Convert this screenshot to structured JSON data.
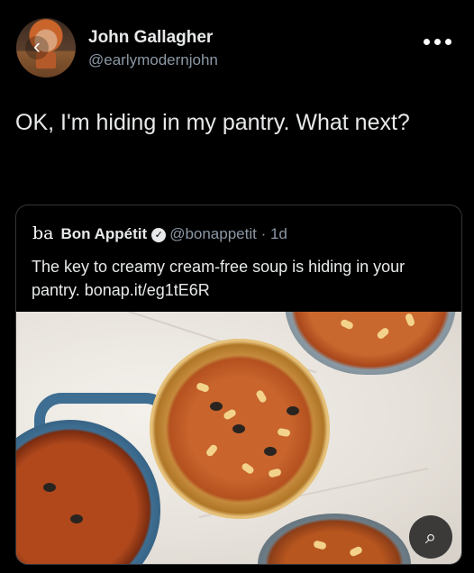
{
  "author": {
    "name": "John Gallagher",
    "handle": "@earlymodernjohn",
    "back_icon": "‹"
  },
  "tweet": {
    "text": "OK, I'm hiding in my pantry. What next?"
  },
  "quoted": {
    "logo": "ba",
    "name": "Bon Appétit",
    "verified_icon": "✓",
    "handle_time": "@bonappetit · 1d",
    "text": "The key to creamy cream-free soup is hiding in your pantry. bonap.it/eg1tE6R"
  },
  "media": {
    "lens_icon": "⌕"
  },
  "colors": {
    "background": "#000000",
    "text": "#e7e9ea",
    "muted": "#8b98a5",
    "border": "#333639"
  }
}
